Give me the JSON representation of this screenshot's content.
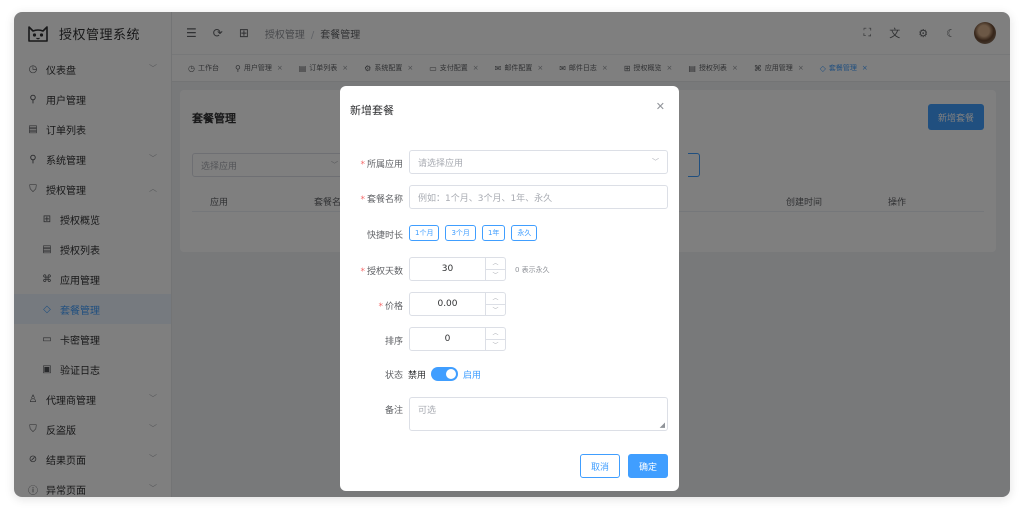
{
  "app": {
    "title": "授权管理系统"
  },
  "sidebar": {
    "items": [
      {
        "label": "仪表盘",
        "icon": "dashboard-icon",
        "glyph": "◷",
        "arrow": "﹀"
      },
      {
        "label": "用户管理",
        "icon": "user-icon",
        "glyph": "⚲",
        "arrow": ""
      },
      {
        "label": "订单列表",
        "icon": "order-list-icon",
        "glyph": "▤",
        "arrow": ""
      },
      {
        "label": "系统管理",
        "icon": "system-icon",
        "glyph": "⚲",
        "arrow": "﹀"
      },
      {
        "label": "授权管理",
        "icon": "shield-icon",
        "glyph": "⛉",
        "arrow": "︿"
      },
      {
        "label": "授权概览",
        "icon": "grid-icon",
        "glyph": "⊞",
        "arrow": ""
      },
      {
        "label": "授权列表",
        "icon": "list-icon",
        "glyph": "▤",
        "arrow": ""
      },
      {
        "label": "应用管理",
        "icon": "apps-icon",
        "glyph": "⌘",
        "arrow": ""
      },
      {
        "label": "套餐管理",
        "icon": "tag-icon",
        "glyph": "◇",
        "arrow": ""
      },
      {
        "label": "卡密管理",
        "icon": "card-icon",
        "glyph": "▭",
        "arrow": ""
      },
      {
        "label": "验证日志",
        "icon": "log-icon",
        "glyph": "▣",
        "arrow": ""
      },
      {
        "label": "代理商管理",
        "icon": "agent-icon",
        "glyph": "♙",
        "arrow": "﹀"
      },
      {
        "label": "反盗版",
        "icon": "anti-piracy-icon",
        "glyph": "⛉",
        "arrow": "﹀"
      },
      {
        "label": "结果页面",
        "icon": "check-circle-icon",
        "glyph": "⊘",
        "arrow": "﹀"
      },
      {
        "label": "异常页面",
        "icon": "warning-circle-icon",
        "glyph": "ⓘ",
        "arrow": "﹀"
      }
    ]
  },
  "header": {
    "breadcrumb": [
      "授权管理",
      "套餐管理"
    ]
  },
  "tabs": [
    {
      "label": "工作台",
      "glyph": "◷",
      "icon": "dashboard-icon"
    },
    {
      "label": "用户管理",
      "glyph": "⚲",
      "icon": "user-icon"
    },
    {
      "label": "订单列表",
      "glyph": "▤",
      "icon": "order-list-icon"
    },
    {
      "label": "系统配置",
      "glyph": "⚙",
      "icon": "gear-icon"
    },
    {
      "label": "支付配置",
      "glyph": "▭",
      "icon": "payment-icon"
    },
    {
      "label": "邮件配置",
      "glyph": "✉",
      "icon": "mail-icon"
    },
    {
      "label": "邮件日志",
      "glyph": "✉",
      "icon": "mail-icon"
    },
    {
      "label": "授权概览",
      "glyph": "⊞",
      "icon": "grid-icon"
    },
    {
      "label": "授权列表",
      "glyph": "▤",
      "icon": "list-icon"
    },
    {
      "label": "应用管理",
      "glyph": "⌘",
      "icon": "apps-icon"
    },
    {
      "label": "套餐管理",
      "glyph": "◇",
      "icon": "tag-icon"
    }
  ],
  "page": {
    "title": "套餐管理",
    "add_button": "新增套餐",
    "filter_placeholder": "选择应用",
    "columns": [
      "应用",
      "套餐名称",
      "创建时间",
      "操作"
    ]
  },
  "modal": {
    "title": "新增套餐",
    "fields": {
      "app": {
        "label": "所属应用",
        "placeholder": "请选择应用"
      },
      "name": {
        "label": "套餐名称",
        "placeholder": "例如：1个月、3个月、1年、永久"
      },
      "quick": {
        "label": "快捷时长",
        "options": [
          "1个月",
          "3个月",
          "1年",
          "永久"
        ]
      },
      "days": {
        "label": "授权天数",
        "value": "30",
        "hint": "0 表示永久"
      },
      "price": {
        "label": "价格",
        "value": "0.00"
      },
      "sort": {
        "label": "排序",
        "value": "0"
      },
      "status": {
        "label": "状态",
        "off_label": "禁用",
        "on_label": "启用",
        "enabled": true
      },
      "remark": {
        "label": "备注",
        "placeholder": "可选"
      }
    },
    "cancel": "取消",
    "confirm": "确定"
  },
  "colors": {
    "primary": "#409eff",
    "required": "#f56c6c"
  }
}
